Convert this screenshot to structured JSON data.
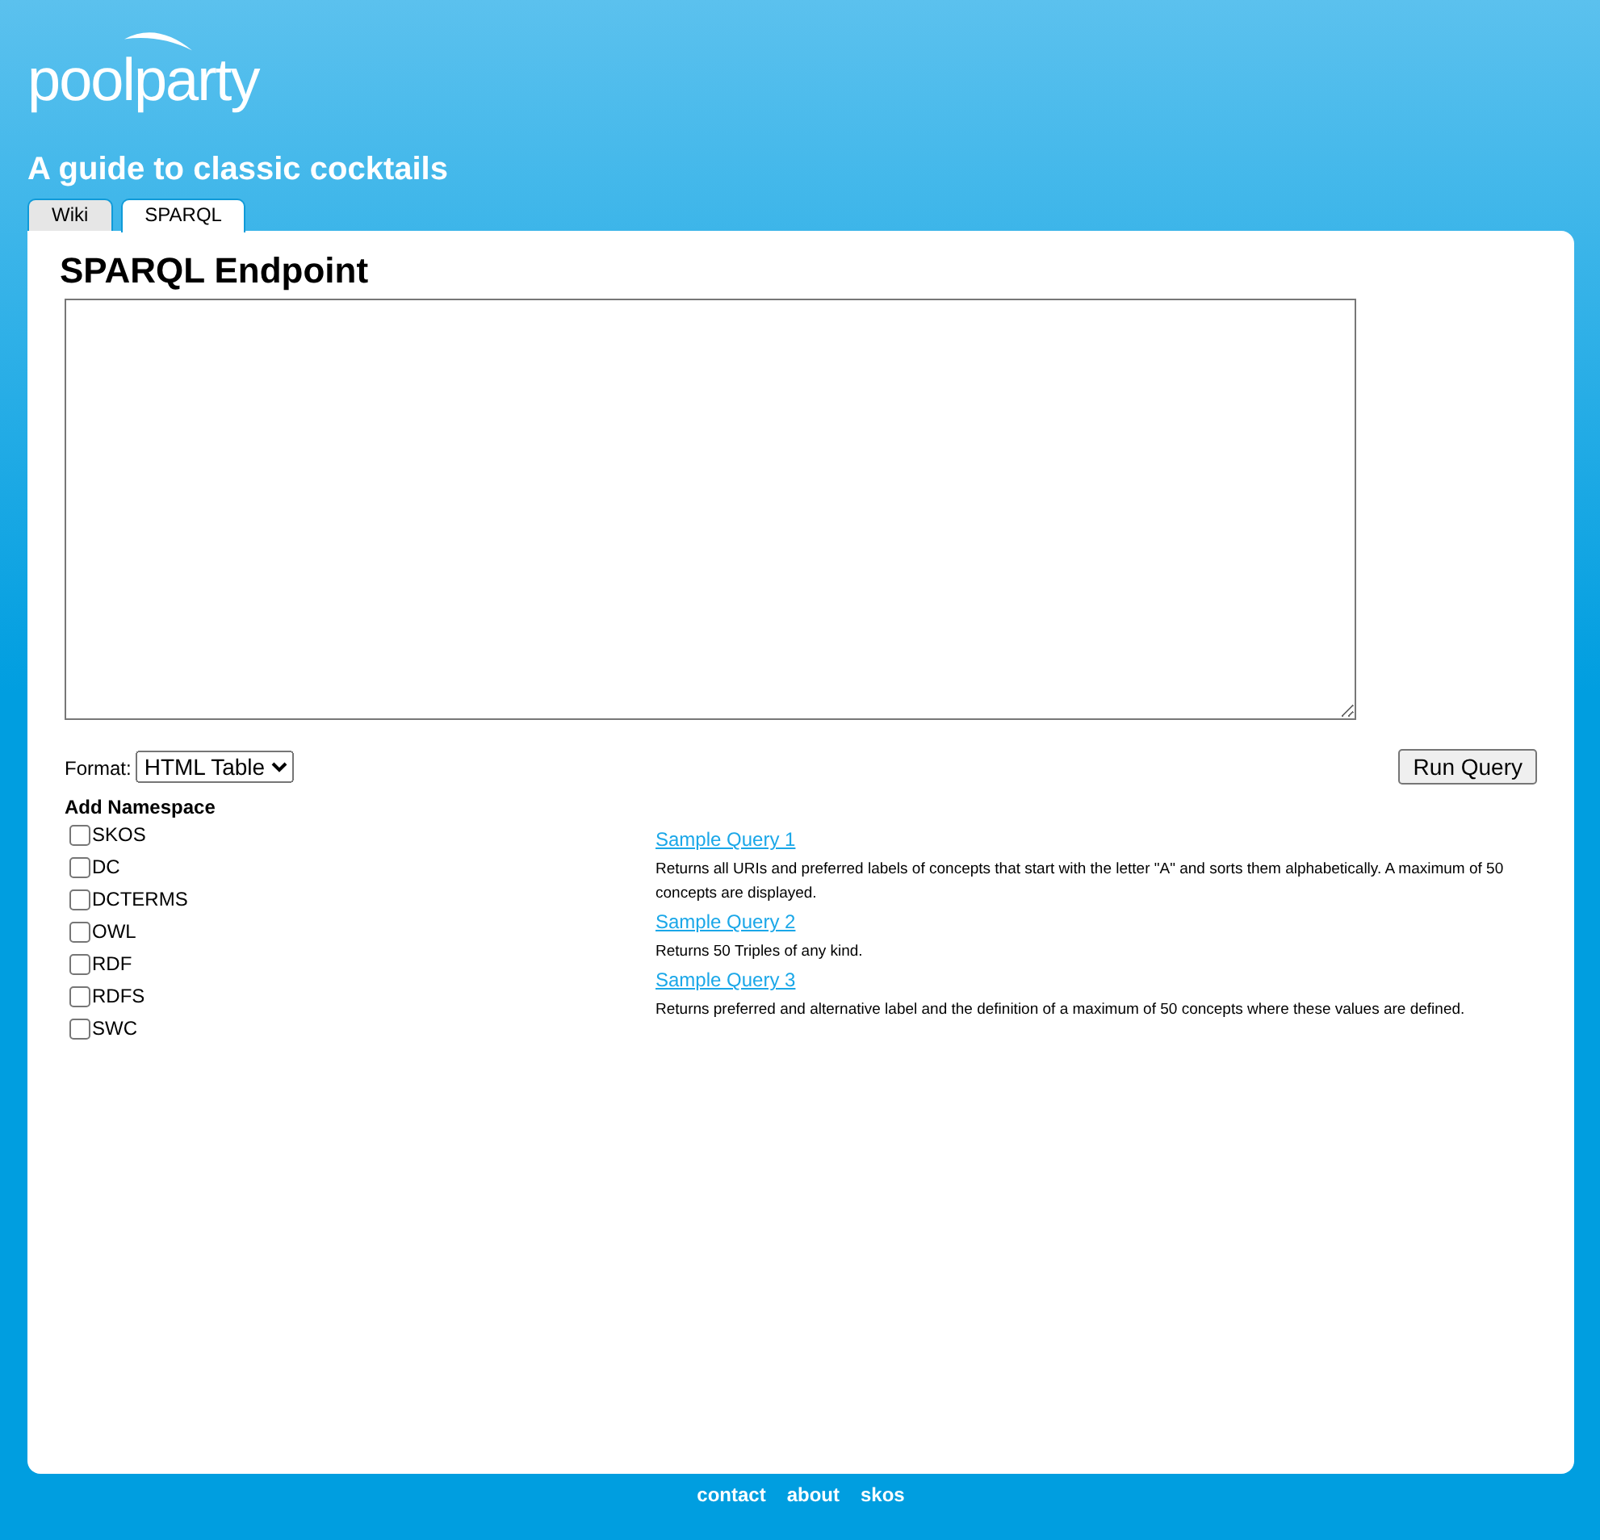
{
  "logo": {
    "text": "poolparty"
  },
  "site_title": "A guide to classic cocktails",
  "tabs": [
    {
      "label": "Wiki",
      "selected": false
    },
    {
      "label": "SPARQL",
      "selected": true
    }
  ],
  "heading": "SPARQL Endpoint",
  "format": {
    "label": "Format:",
    "value": "HTML Table"
  },
  "run_button": "Run Query",
  "namespace": {
    "title": "Add Namespace",
    "items": [
      {
        "label": "SKOS",
        "checked": false
      },
      {
        "label": "DC",
        "checked": false
      },
      {
        "label": "DCTERMS",
        "checked": false
      },
      {
        "label": "OWL",
        "checked": false
      },
      {
        "label": "RDF",
        "checked": false
      },
      {
        "label": "RDFS",
        "checked": false
      },
      {
        "label": "SWC",
        "checked": false
      }
    ]
  },
  "samples": [
    {
      "link": "Sample Query 1",
      "description": "Returns all URIs and preferred labels of concepts that start with the letter \"A\" and sorts them alphabetically. A maximum of 50 concepts are displayed."
    },
    {
      "link": "Sample Query 2",
      "description": "Returns 50 Triples of any kind."
    },
    {
      "link": "Sample Query 3",
      "description": "Returns preferred and alternative label and the definition of a maximum of 50 concepts where these values are defined."
    }
  ],
  "footer_links": [
    "contact",
    "about",
    "skos"
  ]
}
